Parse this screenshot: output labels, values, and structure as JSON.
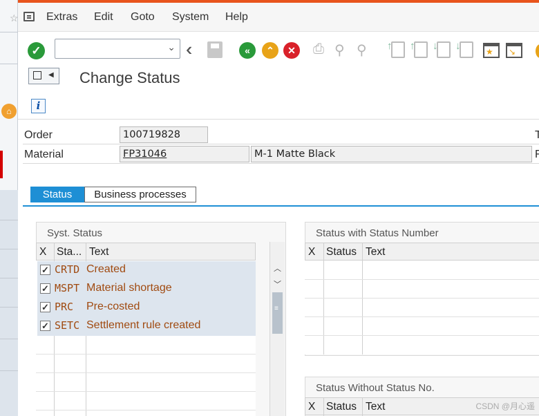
{
  "menu": {
    "items": [
      "Extras",
      "Edit",
      "Goto",
      "System",
      "Help"
    ]
  },
  "toolbar": {
    "command_field_value": ""
  },
  "page": {
    "title": "Change Status",
    "info_glyph": "i"
  },
  "header": {
    "order_label": "Order",
    "order_value": "100719828",
    "material_label": "Material",
    "material_value": "FP31046",
    "material_desc": "M-1 Matte Black",
    "right_edge_char_1": "T",
    "right_edge_char_2": "F"
  },
  "tabs": [
    {
      "label": "Status",
      "active": true
    },
    {
      "label": "Business processes",
      "active": false
    }
  ],
  "syst_status": {
    "title": "Syst. Status",
    "columns": [
      "X",
      "Sta...",
      "Text"
    ],
    "rows": [
      {
        "checked": true,
        "code": "CRTD",
        "text": "Created"
      },
      {
        "checked": true,
        "code": "MSPT",
        "text": "Material shortage"
      },
      {
        "checked": true,
        "code": "PRC",
        "text": "Pre-costed"
      },
      {
        "checked": true,
        "code": "SETC",
        "text": "Settlement rule created"
      }
    ]
  },
  "status_with_number": {
    "title": "Status with Status Number",
    "columns": [
      "X",
      "Status",
      "Text"
    ]
  },
  "status_without_number": {
    "title": "Status Without Status No.",
    "columns": [
      "X",
      "Status",
      "Text"
    ]
  },
  "watermark": "CSDN @月心遥",
  "colors": {
    "accent_tab": "#1e8fd5",
    "status_text": "#a04a10",
    "top_line": "#e8541c",
    "check_green": "#2a9a3a",
    "cancel_red": "#d9212a",
    "exit_orange": "#e8a318"
  }
}
